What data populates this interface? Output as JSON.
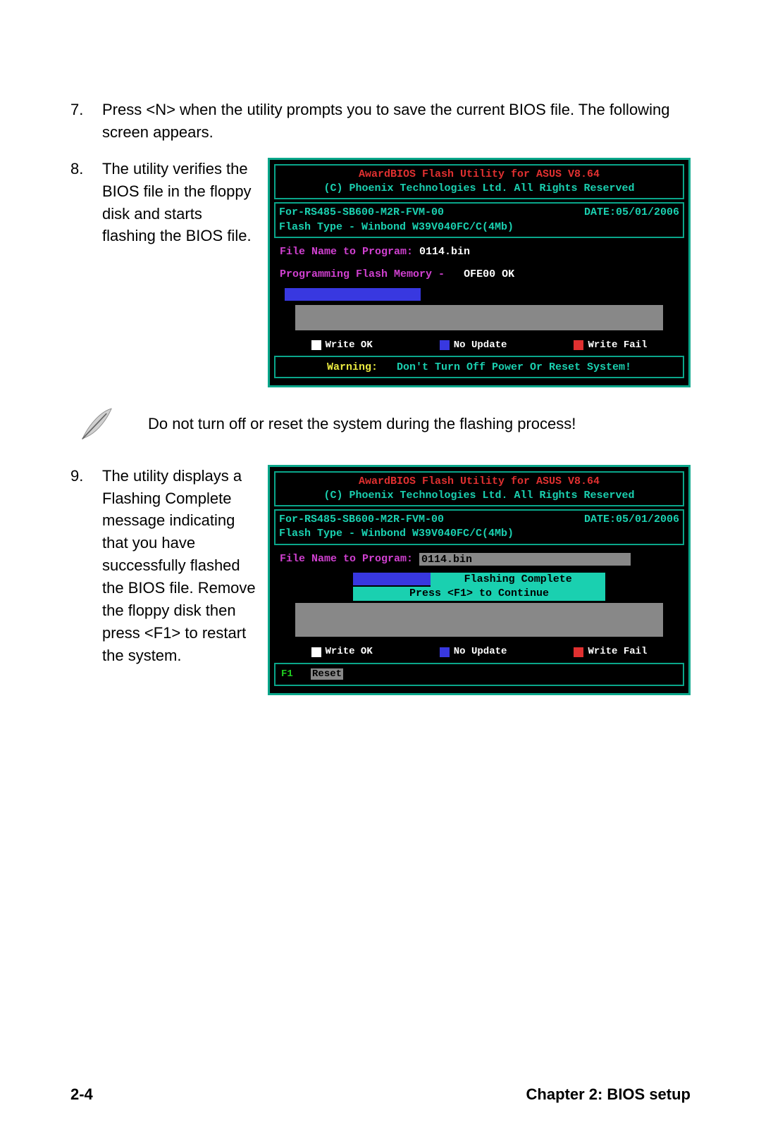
{
  "steps": {
    "s7": {
      "num": "7.",
      "text": "Press <N> when the utility prompts you to save the current BIOS file. The following screen appears."
    },
    "s8": {
      "num": "8.",
      "text": "The utility verifies the BIOS file in the floppy disk and starts flashing the BIOS file."
    },
    "s9": {
      "num": "9.",
      "text": "The utility displays a Flashing Complete message indicating that you have successfully flashed the BIOS file. Remove the floppy disk then press <F1> to restart the system."
    }
  },
  "note": "Do not turn off or reset the system during the flashing process!",
  "bios1": {
    "title": "AwardBIOS Flash Utility for ASUS V8.64",
    "copyright": "(C) Phoenix Technologies Ltd. All Rights Reserved",
    "for_line": "For-RS485-SB600-M2R-FVM-00",
    "date_label": "DATE:",
    "date_value": "05/01/2006",
    "flash_type": "Flash Type - Winbond W39V040FC/C(4Mb)",
    "file_label": "File Name to Program:",
    "file_value": "0114.bin",
    "prog_label": "Programming Flash Memory -",
    "prog_value": "OFE00 OK",
    "legend": {
      "ok": "Write OK",
      "nu": "No Update",
      "wf": "Write Fail"
    },
    "warn_prefix": "Warning:",
    "warn_text": "Don't Turn Off Power Or Reset System!"
  },
  "bios2": {
    "title": "AwardBIOS Flash Utility for ASUS V8.64",
    "copyright": "(C) Phoenix Technologies Ltd. All Rights Reserved",
    "for_line": "For-RS485-SB600-M2R-FVM-00",
    "date_label": "DATE:",
    "date_value": "05/01/2006",
    "flash_type": "Flash Type - Winbond W39V040FC/C(4Mb)",
    "file_label": "File Name to Program:",
    "file_value": "0114.bin",
    "msg1": "Flashing Complete",
    "msg2": "Press <F1> to Continue",
    "legend": {
      "ok": "Write OK",
      "nu": "No Update",
      "wf": "Write Fail"
    },
    "f1": "F1",
    "reset": "Reset"
  },
  "footer": {
    "page": "2-4",
    "chapter": "Chapter 2: BIOS setup"
  }
}
